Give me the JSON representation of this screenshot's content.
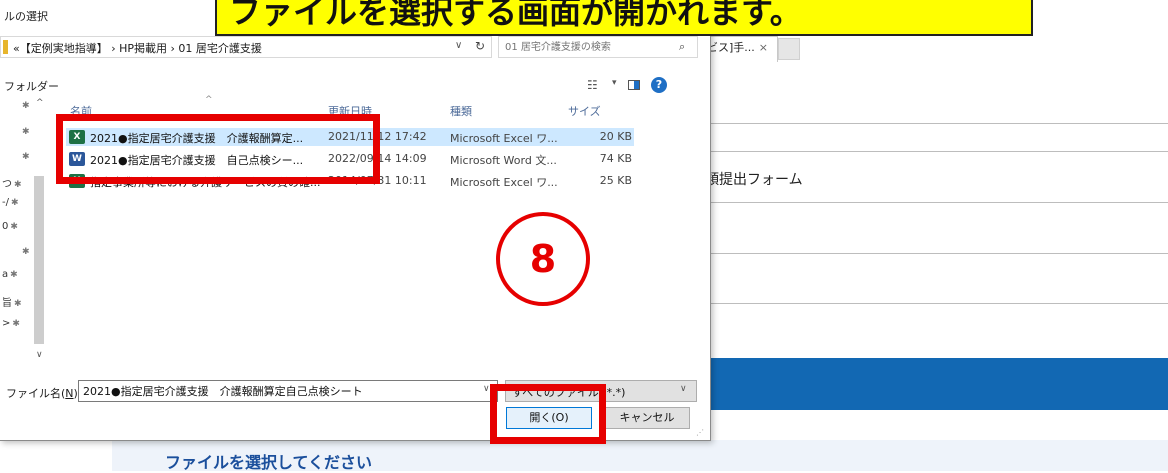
{
  "background": {
    "tab_label": "ビス]手...",
    "tab_close": "×",
    "form_item": "類提出フォーム",
    "panel_text": "ファイルを選択してください"
  },
  "dialog": {
    "title": "ルの選択",
    "breadcrumb": "«【定例実地指導】 › HP掲載用 › 01 居宅介護支援",
    "address_chevron": "∨",
    "refresh_icon": "↻",
    "search_placeholder": "01 居宅介護支援の検索",
    "search_icon": "⌕",
    "toolbar_label": "フォルダー",
    "view_icon": "☷",
    "view_chevron": "▾",
    "help_label": "?",
    "nav_items": [
      {
        "label": "",
        "pin": "✱"
      },
      {
        "label": "",
        "pin": "✱"
      },
      {
        "label": "",
        "pin": "✱"
      },
      {
        "label": "つ",
        "pin": "✱"
      },
      {
        "label": "-/",
        "pin": "✱"
      },
      {
        "label": "0",
        "pin": "✱"
      },
      {
        "label": "",
        "pin": "✱"
      },
      {
        "label": "a",
        "pin": "✱"
      },
      {
        "label": "旨",
        "pin": "✱"
      },
      {
        "label": ">",
        "pin": "✱"
      }
    ],
    "nav_up": "^",
    "nav_down": "∨",
    "columns": {
      "name": "名前",
      "date": "更新日時",
      "type": "種類",
      "size": "サイズ"
    },
    "files": [
      {
        "icon": "X",
        "kind": "xl",
        "name": "2021●指定居宅介護支援　介護報酬算定...",
        "date": "2021/11/12 17:42",
        "type": "Microsoft Excel ワ...",
        "size": "20 KB",
        "selected": true
      },
      {
        "icon": "W",
        "kind": "wd",
        "name": "2021●指定居宅介護支援　自己点検シー...",
        "date": "2022/09/14 14:09",
        "type": "Microsoft Word 文...",
        "size": "74 KB",
        "selected": false
      },
      {
        "icon": "X",
        "kind": "xl",
        "name": "指定事業所等における介護サービスの質の確...",
        "date": "2014/07/31 10:11",
        "type": "Microsoft Excel ワ...",
        "size": "25 KB",
        "selected": false
      }
    ],
    "filename_label_prefix": "ファイル名(",
    "filename_label_key": "N",
    "filename_label_suffix": "):",
    "filename_value": "2021●指定居宅介護支援　介護報酬算定自己点検シート",
    "filter_value": "すべてのファイル (*.*)",
    "open_label": "開く(O)",
    "cancel_label": "キャンセル"
  },
  "annotation": {
    "callout": "ファイルを選択する画面が開かれます。",
    "step_number": "8"
  },
  "colors": {
    "annotation_red": "#e60000",
    "callout_yellow": "#ffff00",
    "selection_blue": "#cde8ff",
    "brand_blue": "#1268b3"
  }
}
